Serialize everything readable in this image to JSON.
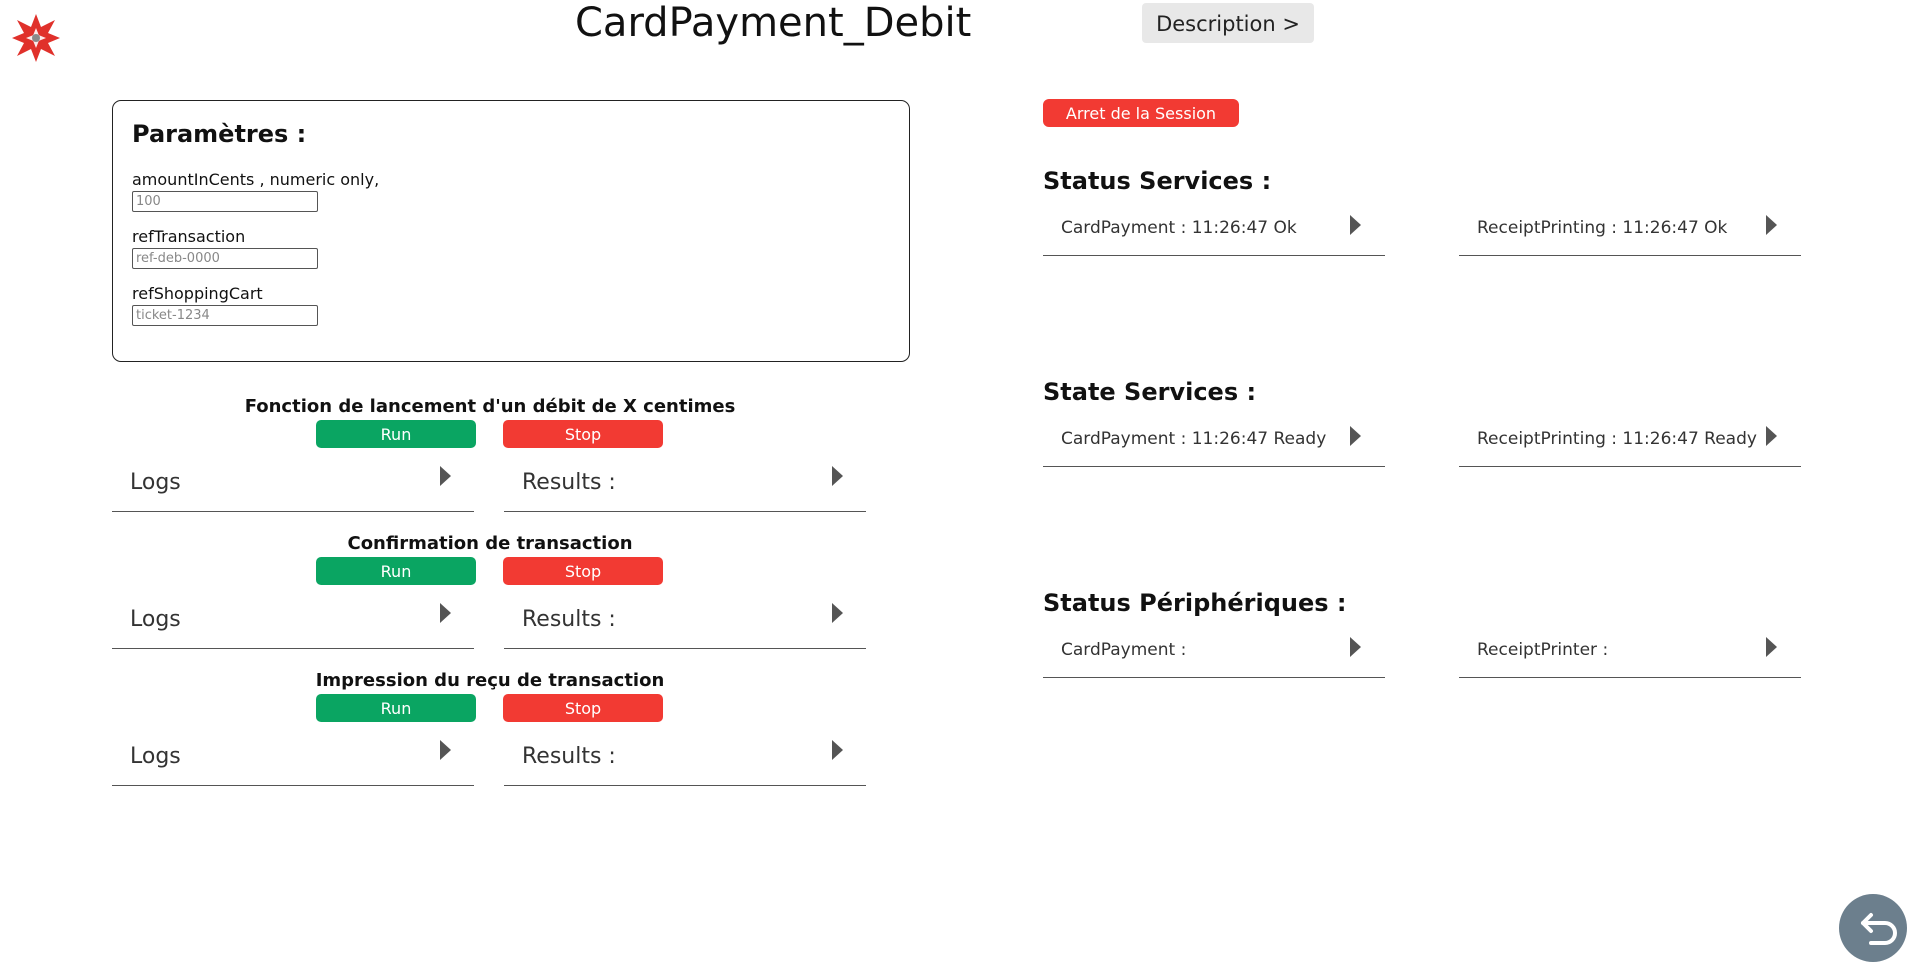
{
  "header": {
    "title": "CardPayment_Debit",
    "description_label": "Description >"
  },
  "params": {
    "title": "Paramètres :",
    "fields": [
      {
        "label": "amountInCents , numeric only,",
        "placeholder": "100"
      },
      {
        "label": "refTransaction",
        "placeholder": "ref-deb-0000"
      },
      {
        "label": "refShoppingCart",
        "placeholder": "ticket-1234"
      }
    ]
  },
  "functions": [
    {
      "title": "Fonction de lancement d'un débit de X centimes",
      "run_label": "Run",
      "stop_label": "Stop",
      "logs_label": "Logs",
      "results_label": "Results :"
    },
    {
      "title": "Confirmation de transaction",
      "run_label": "Run",
      "stop_label": "Stop",
      "logs_label": "Logs",
      "results_label": "Results :"
    },
    {
      "title": "Impression du reçu de transaction",
      "run_label": "Run",
      "stop_label": "Stop",
      "logs_label": "Logs",
      "results_label": "Results :"
    }
  ],
  "session": {
    "stop_label": "Arret de la Session"
  },
  "status_services": {
    "title": "Status Services :",
    "items": [
      "CardPayment : 11:26:47 Ok",
      "ReceiptPrinting : 11:26:47 Ok"
    ]
  },
  "state_services": {
    "title": "State Services :",
    "items": [
      "CardPayment : 11:26:47 Ready",
      "ReceiptPrinting : 11:26:47 Ready"
    ]
  },
  "status_peripherals": {
    "title": "Status Périphériques :",
    "items": [
      "CardPayment :",
      "ReceiptPrinter :"
    ]
  },
  "colors": {
    "run": "#0aa562",
    "stop": "#f23a33",
    "logo": "#e0312b",
    "back_button": "#6c7f8d"
  },
  "icons": {
    "logo": "star-logo-icon",
    "expand": "caret-right-icon",
    "back": "back-arrow-icon"
  }
}
